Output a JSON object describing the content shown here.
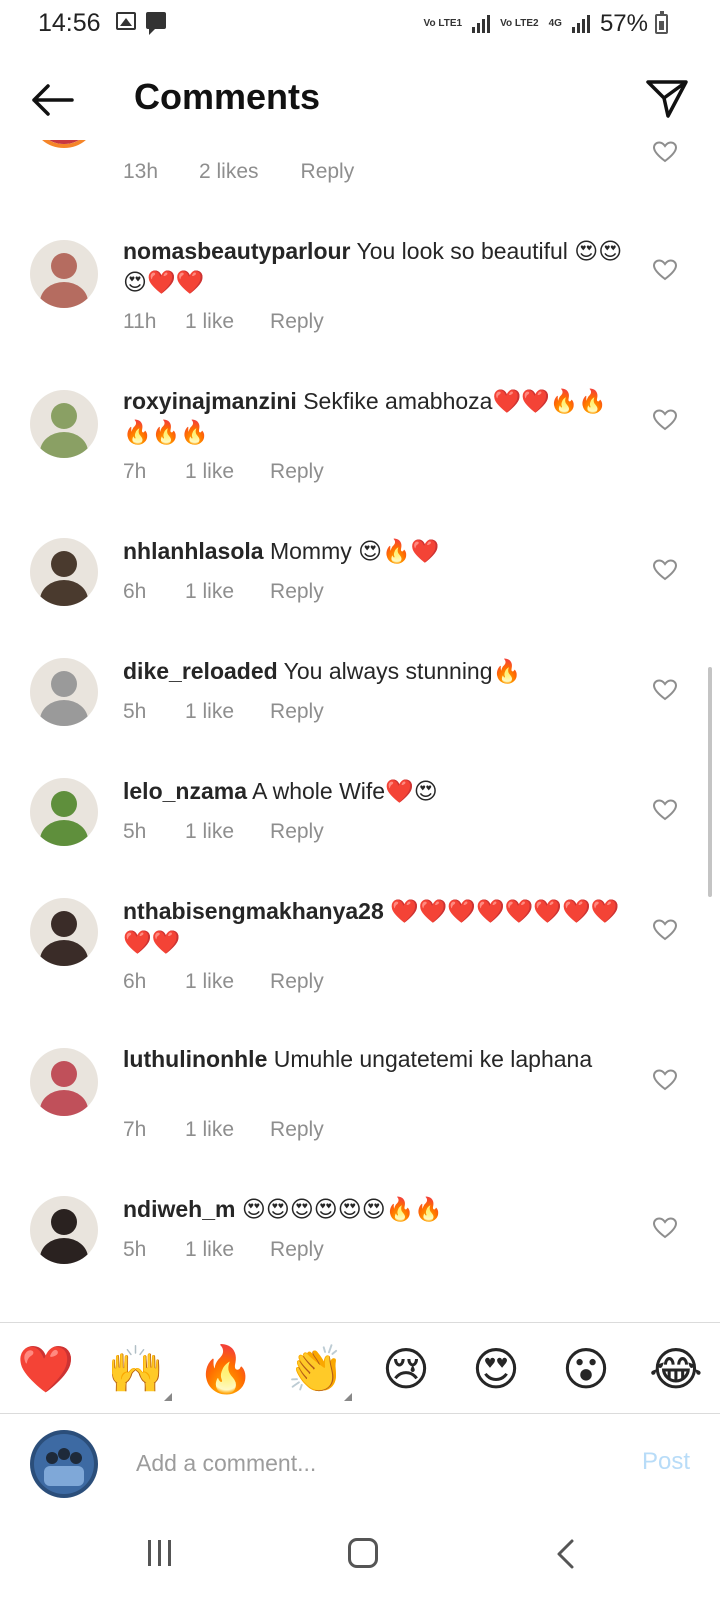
{
  "status_bar": {
    "time": "14:56",
    "battery": "57%",
    "sim1": "Vo LTE1",
    "sim2": "Vo LTE2",
    "network": "4G"
  },
  "header": {
    "title": "Comments"
  },
  "comments": [
    {
      "user": "",
      "text": "",
      "time": "13h",
      "likes": "2 likes",
      "reply": "Reply",
      "avatar_color": "#c8373f"
    },
    {
      "user": "nomasbeautyparlour",
      "text": " You look so beautiful 😍😍😍❤️❤️",
      "time": "11h",
      "likes": "1 like",
      "reply": "Reply",
      "avatar_color": "#b56c60"
    },
    {
      "user": "roxyinajmanzini",
      "text": " Sekfike amabhoza❤️❤️🔥🔥🔥🔥🔥",
      "time": "7h",
      "likes": "1 like",
      "reply": "Reply",
      "avatar_color": "#8aa064"
    },
    {
      "user": "nhlanhlasola",
      "text": " Mommy 😍🔥❤️",
      "time": "6h",
      "likes": "1 like",
      "reply": "Reply",
      "avatar_color": "#4a3a2e"
    },
    {
      "user": "dike_reloaded",
      "text": " You always stunning🔥",
      "time": "5h",
      "likes": "1 like",
      "reply": "Reply",
      "avatar_color": "#9a9a9a"
    },
    {
      "user": "lelo_nzama",
      "text": " A whole Wife❤️😍",
      "time": "5h",
      "likes": "1 like",
      "reply": "Reply",
      "avatar_color": "#5f8f3c"
    },
    {
      "user": "nthabisengmakhanya28",
      "text": " ❤️❤️❤️❤️❤️❤️❤️❤️❤️❤️",
      "time": "6h",
      "likes": "1 like",
      "reply": "Reply",
      "avatar_color": "#3a2c28"
    },
    {
      "user": "luthulinonhle",
      "text": " Umuhle ungatetemi ke laphana",
      "time": "7h",
      "likes": "1 like",
      "reply": "Reply",
      "avatar_color": "#c0505a"
    },
    {
      "user": "ndiweh_m",
      "text": " 😍😍😍😍😍😍🔥🔥",
      "time": "5h",
      "likes": "1 like",
      "reply": "Reply",
      "avatar_color": "#2a2220"
    }
  ],
  "emoji_bar": [
    "❤️",
    "🙌",
    "🔥",
    "👏",
    "😢",
    "😍",
    "😮",
    "😂"
  ],
  "composer": {
    "placeholder": "Add a comment...",
    "post_label": "Post"
  },
  "colors": {
    "heart_red": "#ed4956",
    "meta_gray": "#8e8e8e",
    "post_blue_disabled": "#b8dcf8"
  }
}
